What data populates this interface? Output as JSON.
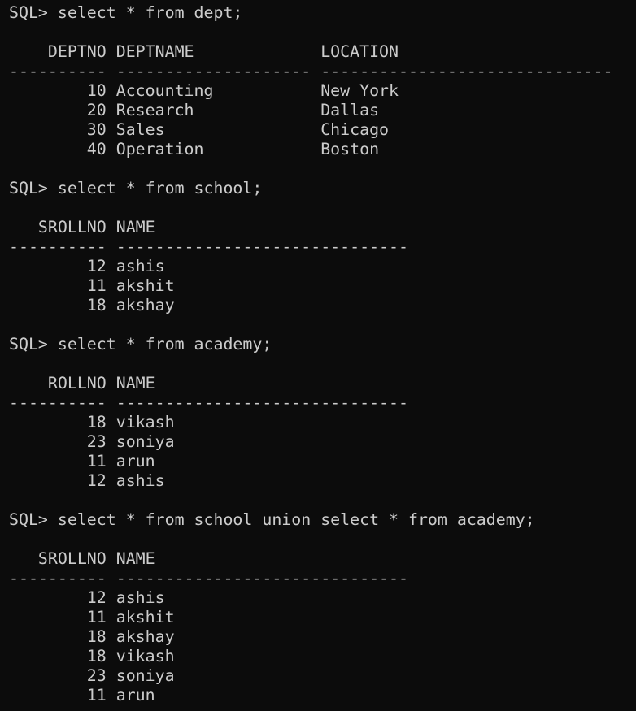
{
  "terminal": {
    "lines": [
      "SQL> select * from dept;",
      "",
      "    DEPTNO DEPTNAME             LOCATION",
      "---------- -------------------- ------------------------------",
      "        10 Accounting           New York",
      "        20 Research             Dallas",
      "        30 Sales                Chicago",
      "        40 Operation            Boston",
      "",
      "SQL> select * from school;",
      "",
      "   SROLLNO NAME",
      "---------- ------------------------------",
      "        12 ashis",
      "        11 akshit",
      "        18 akshay",
      "",
      "SQL> select * from academy;",
      "",
      "    ROLLNO NAME",
      "---------- ------------------------------",
      "        18 vikash",
      "        23 soniya",
      "        11 arun",
      "        12 ashis",
      "",
      "SQL> select * from school union select * from academy;",
      "",
      "   SROLLNO NAME",
      "---------- ------------------------------",
      "        12 ashis",
      "        11 akshit",
      "        18 akshay",
      "        18 vikash",
      "        23 soniya",
      "        11 arun"
    ]
  }
}
